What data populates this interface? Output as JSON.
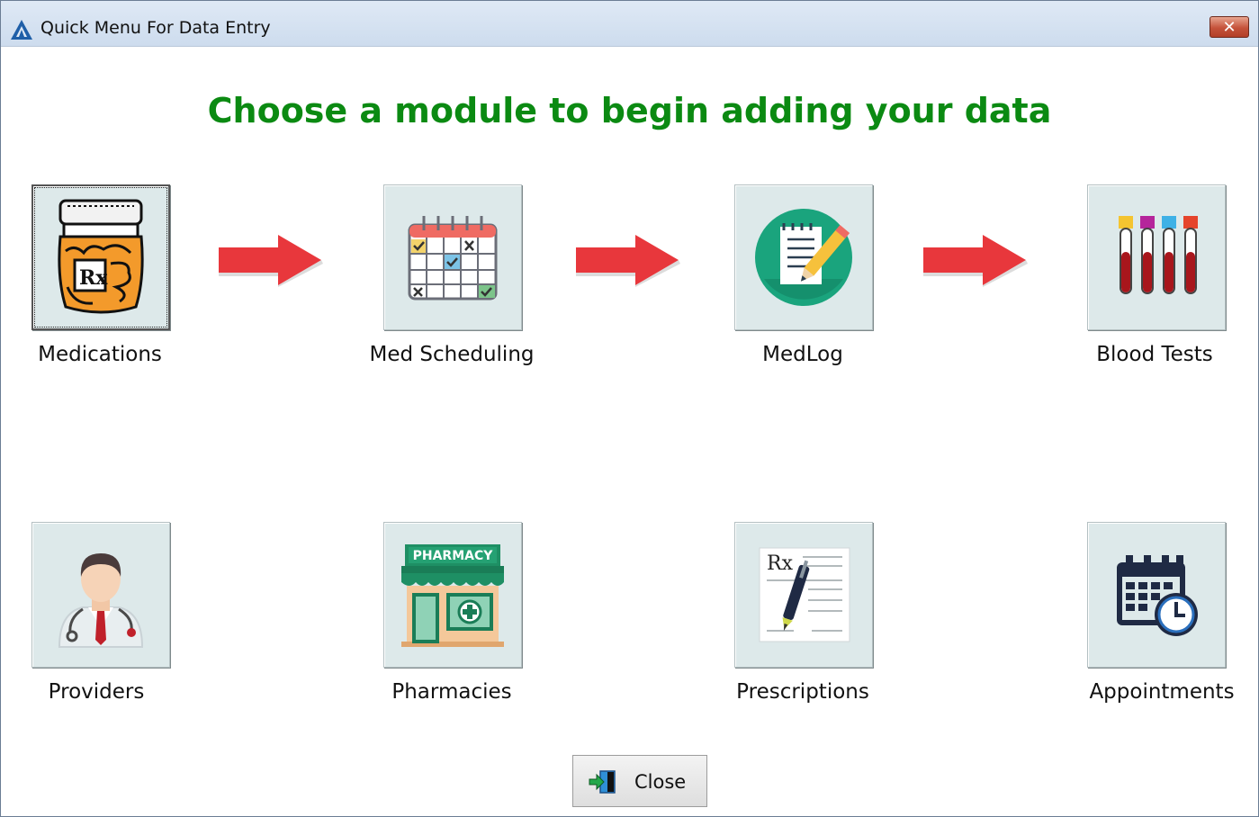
{
  "window": {
    "title": "Quick Menu For Data Entry",
    "close_glyph": "✕"
  },
  "heading": "Choose a module to begin adding your data",
  "colors": {
    "heading": "#0b8a12",
    "arrow": "#e8373c",
    "tile_bg": "#dde9ea"
  },
  "modules": [
    {
      "label": "Medications",
      "icon": "pill-bottle-icon"
    },
    {
      "label": "Med Scheduling",
      "icon": "calendar-checklist-icon"
    },
    {
      "label": "MedLog",
      "icon": "notepad-pencil-icon"
    },
    {
      "label": "Blood Tests",
      "icon": "test-tubes-icon"
    },
    {
      "label": "Providers",
      "icon": "doctor-icon"
    },
    {
      "label": "Pharmacies",
      "icon": "pharmacy-store-icon"
    },
    {
      "label": "Prescriptions",
      "icon": "prescription-pad-icon"
    },
    {
      "label": "Appointments",
      "icon": "calendar-clock-icon"
    }
  ],
  "pharmacy_sign": "PHARMACY",
  "rx_symbol": "Rx",
  "close_button": {
    "label": "Close",
    "icon": "exit-door-icon"
  }
}
